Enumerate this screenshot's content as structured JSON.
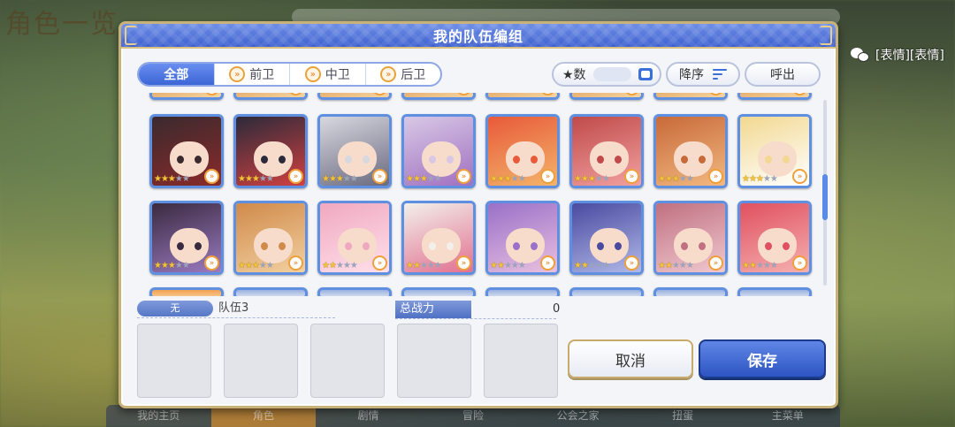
{
  "background": {
    "screen_title": "角色一览",
    "bottom_tabs": [
      "我的主页",
      "角色",
      "剧情",
      "冒险",
      "公会之家",
      "扭蛋",
      "主菜单"
    ]
  },
  "watermark": {
    "text": "[表情][表情]",
    "icon": "wechat-icon"
  },
  "dialog": {
    "title": "我的队伍编组",
    "filter_tabs": [
      {
        "label": "全部",
        "active": true
      },
      {
        "label": "前卫",
        "icon": "role-arrow-icon"
      },
      {
        "label": "中卫",
        "icon": "role-arrow-icon"
      },
      {
        "label": "后卫",
        "icon": "role-arrow-icon"
      }
    ],
    "sort_label": "★数",
    "order_label": "降序",
    "call_label": "呼出",
    "team": {
      "tag": "无",
      "name": "队伍3",
      "power_label": "总战力",
      "power_value": "0"
    },
    "cancel_label": "取消",
    "save_label": "保存",
    "characters_row1": [
      {
        "stars": 3,
        "colors": [
          "#3a2a2e",
          "#8a2a2a"
        ]
      },
      {
        "stars": 3,
        "colors": [
          "#2c2a3a",
          "#d04040"
        ]
      },
      {
        "stars": 3,
        "colors": [
          "#d8d8e0",
          "#6a6a80"
        ]
      },
      {
        "stars": 3,
        "colors": [
          "#d8c8e6",
          "#a070c0"
        ]
      },
      {
        "stars": 3,
        "colors": [
          "#e85a3a",
          "#f3b46a"
        ]
      },
      {
        "stars": 3,
        "colors": [
          "#c04a4a",
          "#f2a0a0"
        ]
      },
      {
        "stars": 3,
        "colors": [
          "#c86a3a",
          "#f2b880"
        ]
      },
      {
        "stars": 3,
        "colors": [
          "#f2d890",
          "#ffffff"
        ]
      }
    ],
    "characters_row2": [
      {
        "stars": 3,
        "colors": [
          "#3a2a40",
          "#9a7ac0"
        ]
      },
      {
        "stars": 3,
        "colors": [
          "#d08a4a",
          "#f2d0a0"
        ]
      },
      {
        "stars": 2,
        "colors": [
          "#f0a8c0",
          "#ffe0ea"
        ]
      },
      {
        "stars": 2,
        "colors": [
          "#f2f0ea",
          "#e27090"
        ]
      },
      {
        "stars": 2,
        "colors": [
          "#9a70c8",
          "#e8c0e0"
        ]
      },
      {
        "stars": 2,
        "colors": [
          "#4a4aa0",
          "#b0b8e8"
        ]
      },
      {
        "stars": 2,
        "colors": [
          "#c07080",
          "#f0c8d0"
        ]
      },
      {
        "stars": 2,
        "colors": [
          "#e05060",
          "#f5b0b0"
        ]
      }
    ]
  }
}
